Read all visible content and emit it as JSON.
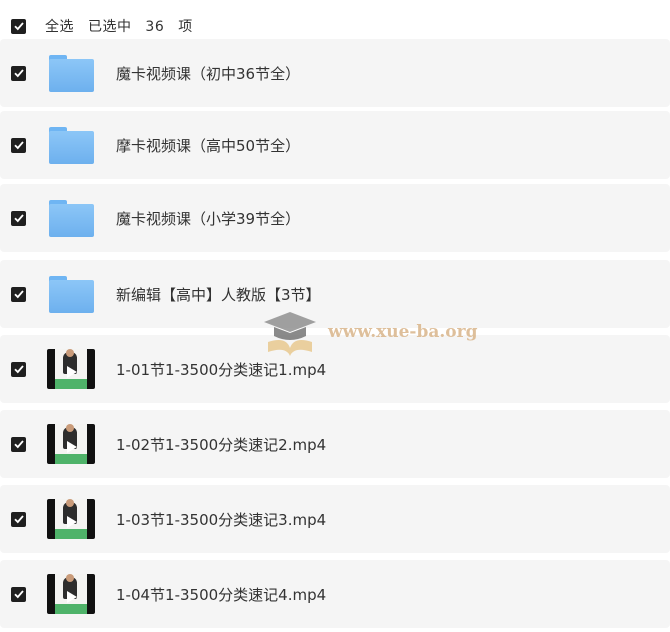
{
  "header": {
    "select_all_label": "全选",
    "selected_prefix": "已选中",
    "selected_count": "36",
    "selected_suffix": "项"
  },
  "files": [
    {
      "type": "folder",
      "name": "魔卡视频课（初中36节全）",
      "checked": true
    },
    {
      "type": "folder",
      "name": "摩卡视频课（高中50节全）",
      "checked": true
    },
    {
      "type": "folder",
      "name": "魔卡视频课（小学39节全）",
      "checked": true
    },
    {
      "type": "folder",
      "name": "新编辑【高中】人教版【3节】",
      "checked": true
    },
    {
      "type": "video",
      "name": "1-01节1-3500分类速记1.mp4",
      "checked": true
    },
    {
      "type": "video",
      "name": "1-02节1-3500分类速记2.mp4",
      "checked": true
    },
    {
      "type": "video",
      "name": "1-03节1-3500分类速记3.mp4",
      "checked": true
    },
    {
      "type": "video",
      "name": "1-04节1-3500分类速记4.mp4",
      "checked": true
    }
  ],
  "watermark": {
    "text": "www.xue-ba.org"
  },
  "colors": {
    "checkbox": "#1f1f1f",
    "row_bg": "#f5f5f5",
    "folder": "#7ab9f2",
    "watermark": "#d9b58a"
  }
}
